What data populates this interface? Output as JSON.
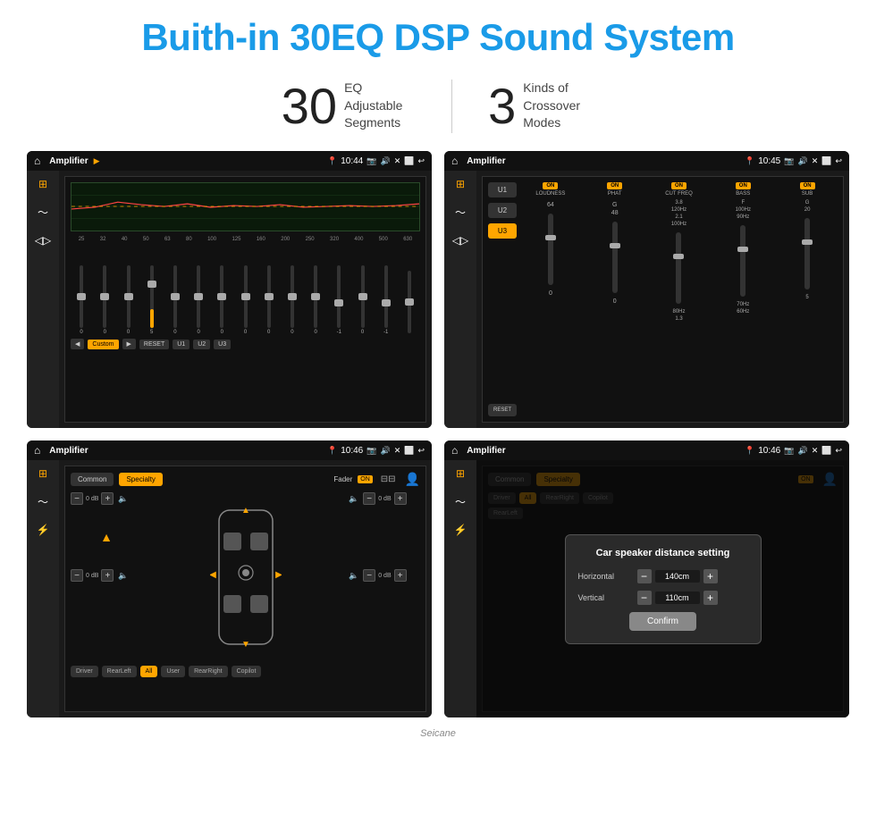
{
  "header": {
    "title": "Buith-in 30EQ DSP Sound System"
  },
  "stats": [
    {
      "number": "30",
      "label": "EQ Adjustable\nSegments"
    },
    {
      "number": "3",
      "label": "Kinds of\nCrossover Modes"
    }
  ],
  "screens": [
    {
      "id": "eq-screen",
      "title": "Amplifier",
      "time": "10:44",
      "type": "eq"
    },
    {
      "id": "crossover-screen",
      "title": "Amplifier",
      "time": "10:45",
      "type": "crossover"
    },
    {
      "id": "balance-screen",
      "title": "Amplifier",
      "time": "10:46",
      "type": "balance"
    },
    {
      "id": "dialog-screen",
      "title": "Amplifier",
      "time": "10:46",
      "type": "balance-dialog"
    }
  ],
  "eq": {
    "frequencies": [
      "25",
      "32",
      "40",
      "50",
      "63",
      "80",
      "100",
      "125",
      "160",
      "200",
      "250",
      "320",
      "400",
      "500",
      "630"
    ],
    "values": [
      "0",
      "0",
      "0",
      "5",
      "0",
      "0",
      "0",
      "0",
      "0",
      "0",
      "0",
      "-1",
      "0",
      "-1",
      ""
    ],
    "presets": [
      "Custom",
      "RESET",
      "U1",
      "U2",
      "U3"
    ]
  },
  "crossover": {
    "presets": [
      "U1",
      "U2",
      "U3",
      "RESET"
    ],
    "channels": [
      "LOUDNESS",
      "PHAT",
      "CUT FREQ",
      "BASS",
      "SUB"
    ]
  },
  "balance": {
    "buttons": [
      "Common",
      "Specialty"
    ],
    "fader": "ON",
    "volumes": [
      "0 dB",
      "0 dB",
      "0 dB",
      "0 dB"
    ],
    "speakers": [
      "Driver",
      "RearLeft",
      "All",
      "User",
      "RearRight",
      "Copilot"
    ]
  },
  "dialog": {
    "title": "Car speaker distance setting",
    "horizontal_label": "Horizontal",
    "horizontal_value": "140cm",
    "vertical_label": "Vertical",
    "vertical_value": "110cm",
    "confirm_label": "Confirm"
  },
  "watermark": "Seicane"
}
